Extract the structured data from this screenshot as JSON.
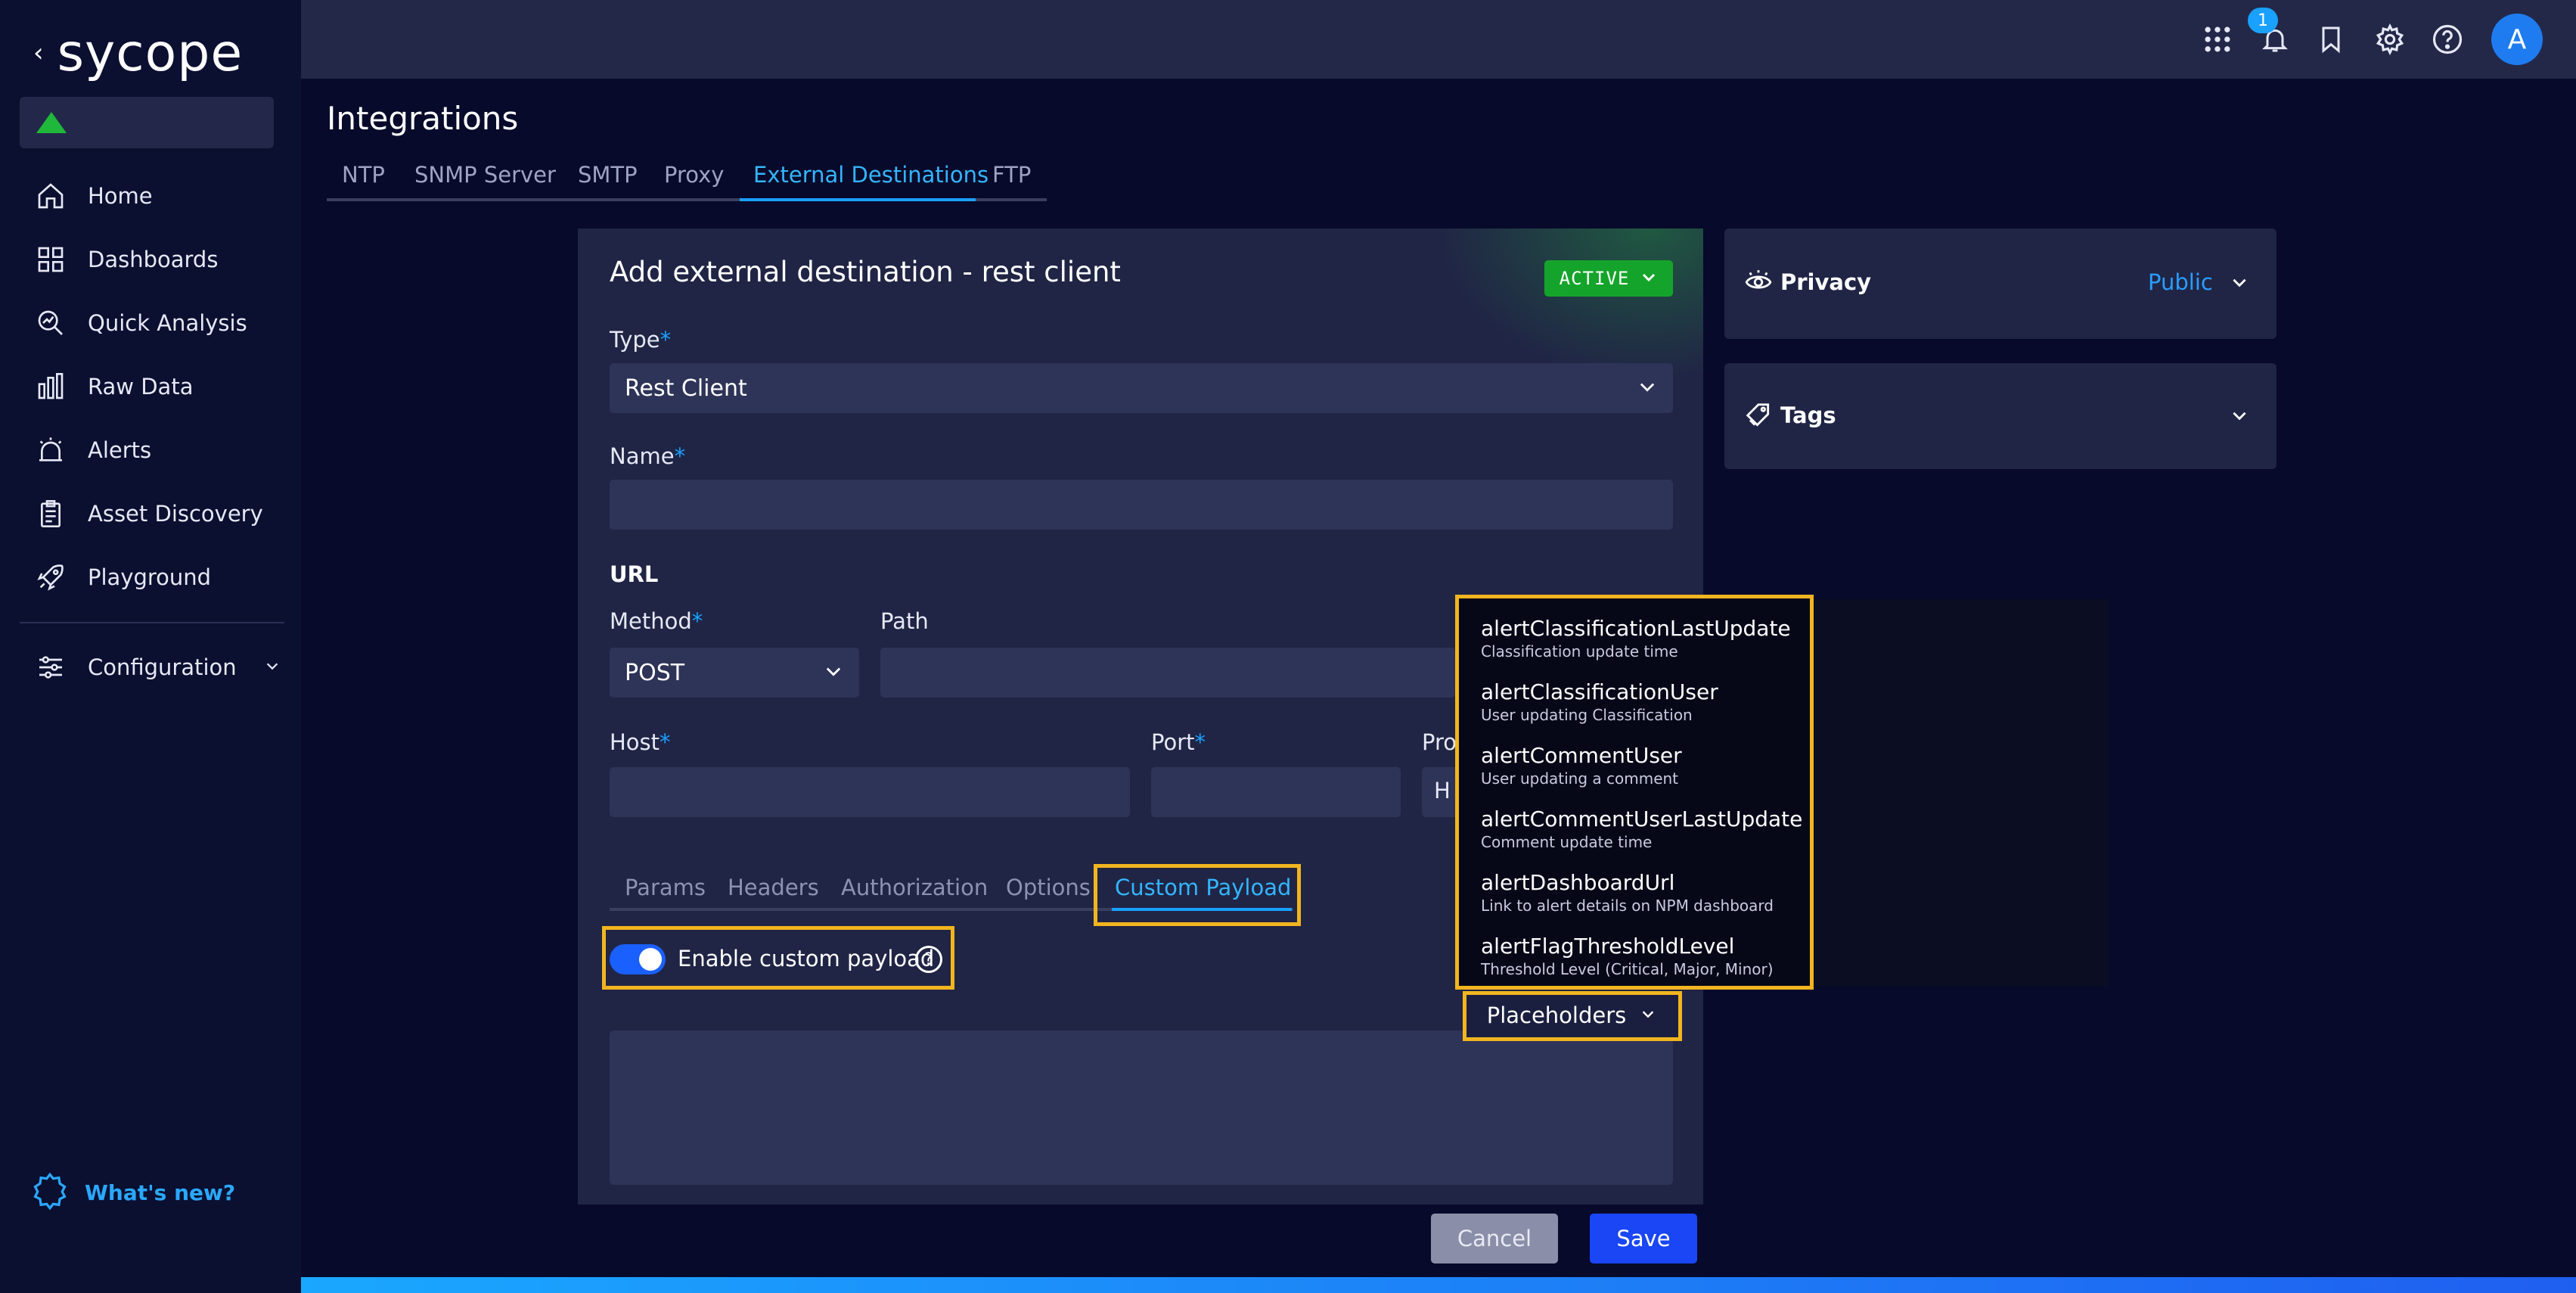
{
  "brand": {
    "back_glyph": "‹",
    "name": "sycope"
  },
  "sidebar": {
    "items": [
      {
        "label": "Home",
        "icon": "home-icon"
      },
      {
        "label": "Dashboards",
        "icon": "dashboards-icon"
      },
      {
        "label": "Quick Analysis",
        "icon": "quick-analysis-icon"
      },
      {
        "label": "Raw Data",
        "icon": "raw-data-icon"
      },
      {
        "label": "Alerts",
        "icon": "alarm-icon"
      },
      {
        "label": "Asset Discovery",
        "icon": "clipboard-icon"
      },
      {
        "label": "Playground",
        "icon": "rocket-icon"
      }
    ],
    "configuration": {
      "label": "Configuration",
      "icon": "sliders-icon"
    },
    "whats_new": "What's new?"
  },
  "topbar": {
    "notification_count": "1",
    "avatar_letter": "A"
  },
  "page": {
    "title": "Integrations",
    "tabs": [
      "NTP",
      "SNMP Server",
      "SMTP",
      "Proxy",
      "External Destinations",
      "FTP"
    ],
    "active_tab": "External Destinations"
  },
  "form": {
    "title": "Add external destination - rest client",
    "status": "ACTIVE",
    "type_label": "Type",
    "type_value": "Rest Client",
    "name_label": "Name",
    "name_value": "",
    "url_section": "URL",
    "method_label": "Method",
    "method_value": "POST",
    "path_label": "Path",
    "path_value": "",
    "host_label": "Host",
    "host_value": "",
    "port_label": "Port",
    "port_value": "",
    "protocol_label_partial": "Pro",
    "protocol_value_partial": "H",
    "required_mark": "*",
    "subtabs": [
      "Params",
      "Headers",
      "Authorization",
      "Options",
      "Custom Payload"
    ],
    "active_subtab": "Custom Payload",
    "enable_custom_payload": {
      "label": "Enable custom payload",
      "checked": true
    },
    "help_glyph": "?",
    "payload_value": ""
  },
  "placeholders": {
    "button_label": "Placeholders",
    "items": [
      {
        "name": "alertClassificationLastUpdate",
        "desc": "Classification update time"
      },
      {
        "name": "alertClassificationUser",
        "desc": "User updating Classification"
      },
      {
        "name": "alertCommentUser",
        "desc": "User updating a comment"
      },
      {
        "name": "alertCommentUserLastUpdate",
        "desc": "Comment update time"
      },
      {
        "name": "alertDashboardUrl",
        "desc": "Link to alert details on NPM dashboard"
      },
      {
        "name": "alertFlagThresholdLevel",
        "desc": "Threshold Level (Critical, Major, Minor)"
      }
    ]
  },
  "privacy": {
    "title": "Privacy",
    "value": "Public"
  },
  "tags": {
    "title": "Tags"
  },
  "actions": {
    "cancel": "Cancel",
    "save": "Save"
  },
  "colors": {
    "accent": "#1aa0ff",
    "active_green": "#15a42b",
    "highlight": "#f2b51f",
    "save_blue": "#1a46f5"
  }
}
